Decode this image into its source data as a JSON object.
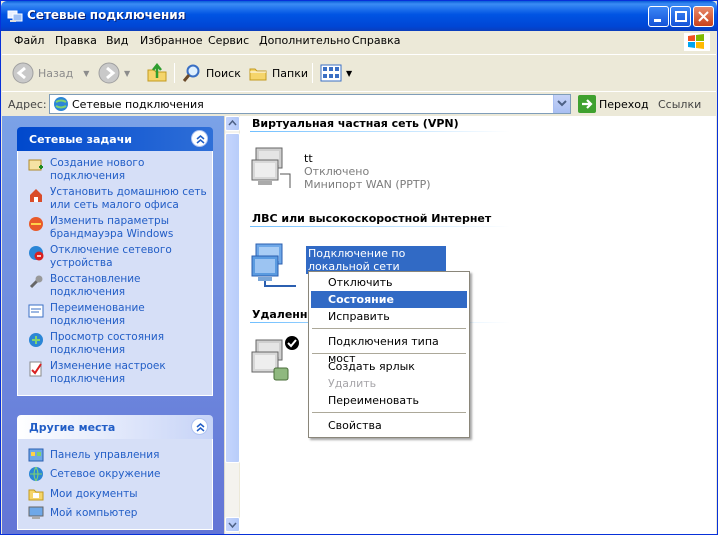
{
  "window": {
    "title": "Сетевые подключения"
  },
  "menu": [
    "Файл",
    "Правка",
    "Вид",
    "Избранное",
    "Сервис",
    "Дополнительно",
    "Справка"
  ],
  "toolbar": {
    "back": "Назад",
    "search": "Поиск",
    "folders": "Папки"
  },
  "address": {
    "label": "Адрес:",
    "value": "Сетевые подключения",
    "go": "Переход",
    "links": "Ссылки"
  },
  "tasks_panel": {
    "title": "Сетевые задачи",
    "items": [
      "Создание нового подключения",
      "Установить домашнюю сеть или сеть малого офиса",
      "Изменить параметры брандмауэра Windows",
      "Отключение сетевого устройства",
      "Восстановление подключения",
      "Переименование подключения",
      "Просмотр состояния подключения",
      "Изменение настроек подключения"
    ]
  },
  "places_panel": {
    "title": "Другие места",
    "items": [
      "Панель управления",
      "Сетевое окружение",
      "Мои документы",
      "Мой компьютер"
    ]
  },
  "groups": {
    "vpn": {
      "title": "Виртуальная частная сеть (VPN)",
      "name": "tt",
      "status": "Отключено",
      "device": "Минипорт WAN (PPTP)"
    },
    "lan": {
      "title": "ЛВС или высокоскоростной Интернет",
      "name": "Подключение по локальной сети"
    },
    "remote": {
      "title": "Удаленный"
    }
  },
  "context_menu": {
    "items": [
      "Отключить",
      "Состояние",
      "Исправить",
      "Подключения типа мост",
      "Создать ярлык",
      "Удалить",
      "Переименовать",
      "Свойства"
    ],
    "highlighted": "Состояние",
    "disabled": [
      "Удалить"
    ]
  },
  "colors": {
    "title_bar": "#0054e3",
    "link": "#215dc6",
    "highlight": "#316ac5"
  }
}
